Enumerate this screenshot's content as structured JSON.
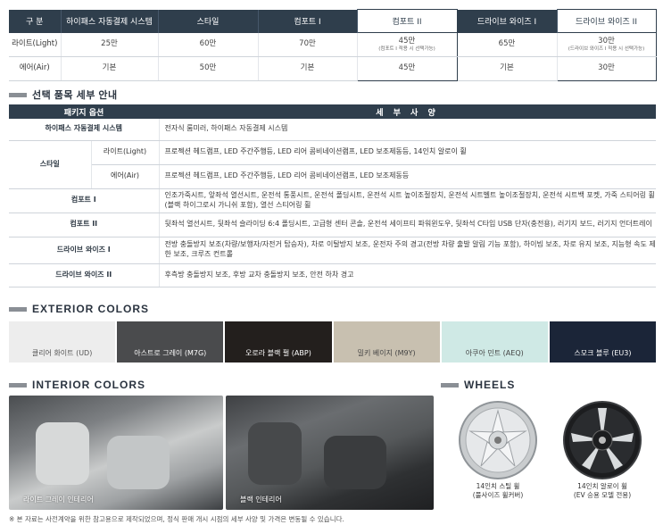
{
  "price_table": {
    "headers": [
      "구 분",
      "하이패스 자동결제 시스템",
      "스타일",
      "컴포트 I",
      "컴포트 II",
      "드라이브 와이즈 I",
      "드라이브 와이즈 II"
    ],
    "rows": [
      {
        "label": "라이트(Light)",
        "cells": [
          "25만",
          "60만",
          "70만",
          "45만",
          "65만",
          "30만"
        ],
        "notes": [
          "",
          "",
          "",
          "(컴포트 I 적용 시 선택가능)",
          "",
          "(드라이브 와이즈 I 적용 시 선택가능)"
        ]
      },
      {
        "label": "에어(Air)",
        "cells": [
          "기본",
          "50만",
          "기본",
          "45만",
          "기본",
          "30만"
        ],
        "notes": [
          "",
          "",
          "",
          "",
          "",
          ""
        ]
      }
    ]
  },
  "option_section": {
    "title": "선택 품목 세부 안내",
    "header_left": "패키지 옵션",
    "header_right": "세 부 사 양",
    "rows": [
      {
        "category": "하이패스 자동결제 시스템",
        "sub": "",
        "desc": "전자식 룸미러, 하이패스 자동결제 시스템",
        "desc_red": ""
      },
      {
        "category": "스타일",
        "sub": "라이트(Light)",
        "desc": "프로젝션 헤드램프, LED 주간주행등, LED 리어 콤비네이션램프, LED 보조제동등, ",
        "desc_red": "14인치 알로이 휠"
      },
      {
        "category": "",
        "sub": "에어(Air)",
        "desc": "프로젝션 헤드램프, LED 주간주행등, LED 리어 콤비네이션램프, LED 보조제동등",
        "desc_red": ""
      },
      {
        "category": "컴포트 I",
        "sub": "",
        "desc": "인조가죽시트, 앞좌석 열선시트, 운전석 통풍시트, 운전석 폴딩시트, 운전석 시트 높이조절장치, 운전석 시트벨트 높이조절장치, 운전석 시트백 포켓, 가죽 스티어링 휠(블랙 하이그로시 가니쉬 포함), 열선 스티어링 휠",
        "desc_red": ""
      },
      {
        "category": "컴포트 II",
        "sub": "",
        "desc": "뒷좌석 열선시트, 뒷좌석 슬라이딩 6:4 폴딩시트, 고급형 센터 콘솔, 운전석 세이프티 파워윈도우, 뒷좌석 C타입 USB 단자(충전용), 러기지 보드, 러기지 언더트레이",
        "desc_red": ""
      },
      {
        "category": "드라이브 와이즈 I",
        "sub": "",
        "desc": "전방 충돌방지 보조(차량/보행자/자전거 탑승자), 차로 이탈방지 보조, 운전자 주의 경고(전방 차량 출발 알림 기능 포함), 하이빔 보조, 차로 유지 보조, 지능형 속도 제한 보조, 크루즈 컨트롤",
        "desc_red": ""
      },
      {
        "category": "드라이브 와이즈 II",
        "sub": "",
        "desc": "후측방 충돌방지 보조, 후방 교차 충돌방지 보조, 안전 하차 경고",
        "desc_red": ""
      }
    ]
  },
  "exterior": {
    "title": "EXTERIOR COLORS",
    "colors": [
      {
        "name": "클리어 화이트 (UD)",
        "hex": "#ededed",
        "text": "#555555"
      },
      {
        "name": "아스트로 그레이 (M7G)",
        "hex": "#4a4b4d",
        "text": "#ffffff"
      },
      {
        "name": "오로라 블랙 펄 (ABP)",
        "hex": "#231f1d",
        "text": "#ffffff"
      },
      {
        "name": "밀키 베이지 (M9Y)",
        "hex": "#c8c0b0",
        "text": "#444444"
      },
      {
        "name": "아쿠아 민트 (AEQ)",
        "hex": "#cfe9e5",
        "text": "#444444"
      },
      {
        "name": "스모크 블루 (EU3)",
        "hex": "#1b2538",
        "text": "#ffffff"
      }
    ]
  },
  "interior": {
    "title": "INTERIOR COLORS",
    "items": [
      {
        "caption": "라이트 그레이 인테리어"
      },
      {
        "caption": "블랙 인테리어"
      }
    ]
  },
  "wheels": {
    "title": "WHEELS",
    "items": [
      {
        "line1": "14인치 스틸 휠",
        "line2": "(풀사이즈 휠커버)"
      },
      {
        "line1": "14인치 알로이 휠",
        "line2": "(EV 승용 모델 전용)"
      }
    ]
  },
  "footnote": "※ 본 자료는 사전계약을 위한 참고용으로 제작되었으며, 정식 판매 개시 시점의 세부 사양 및 가격은 변동될 수 있습니다."
}
